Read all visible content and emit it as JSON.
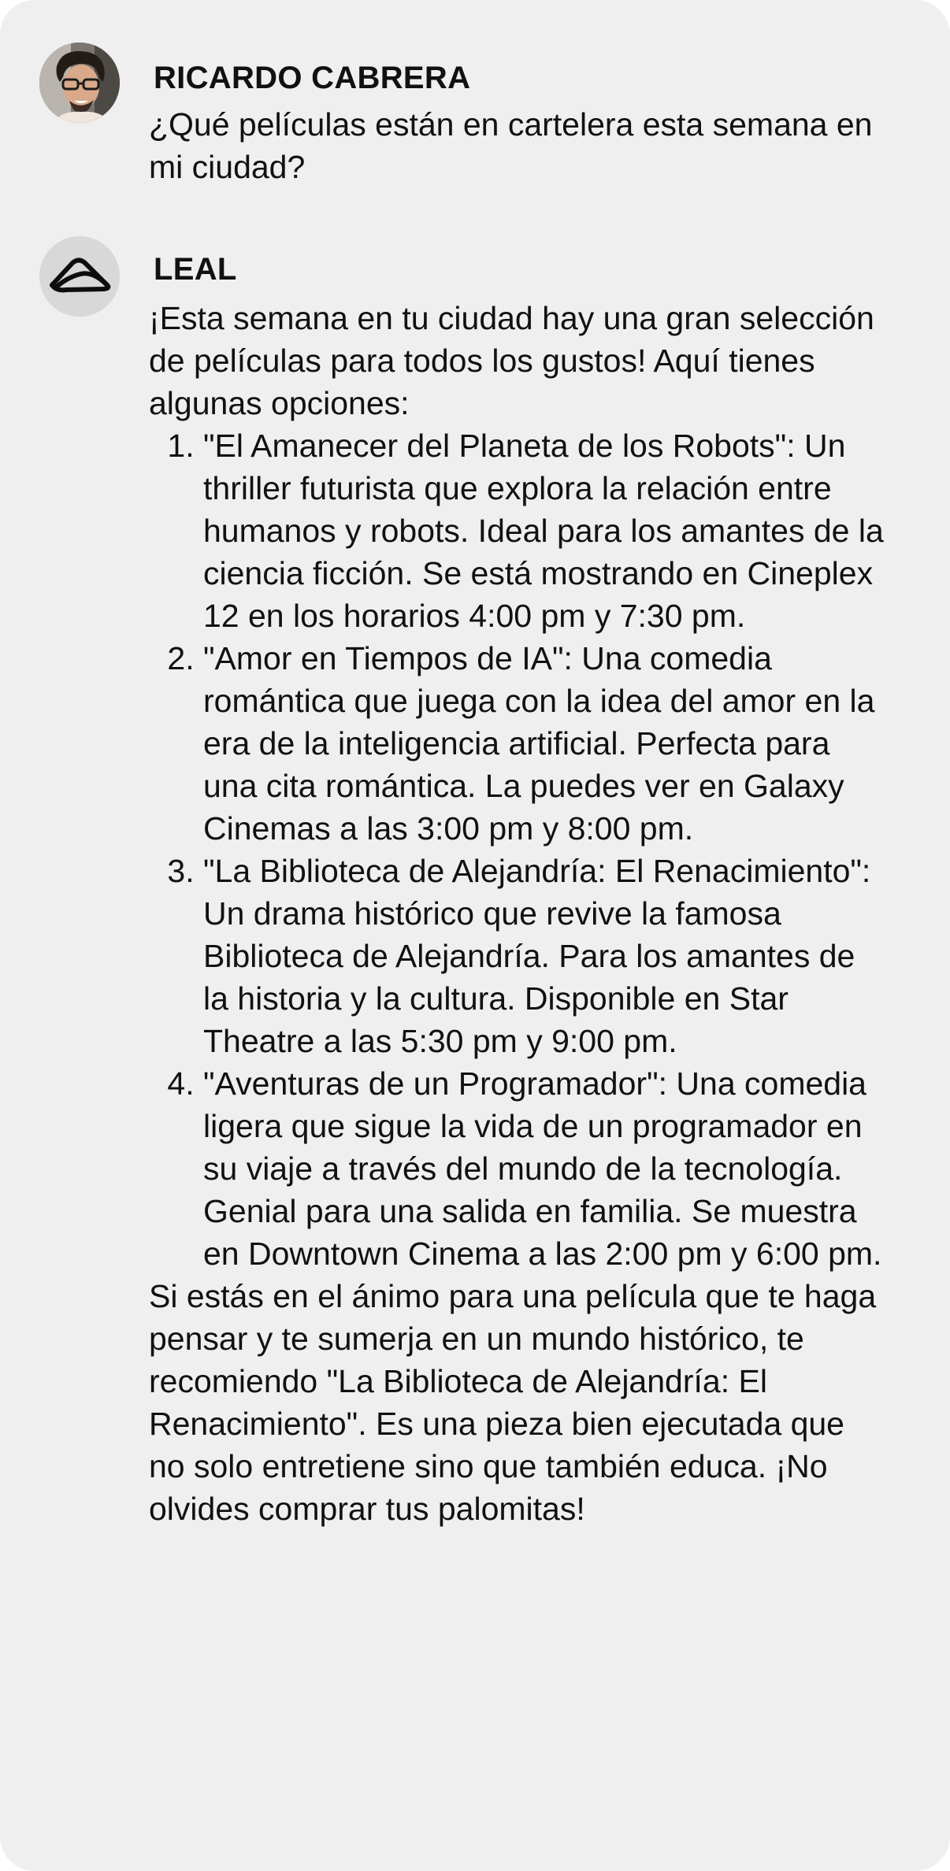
{
  "conversation": {
    "user_message": {
      "sender": "RICARDO CABRERA",
      "avatar_icon": "user-photo",
      "text": "¿Qué películas están en cartelera esta semana en mi ciudad?"
    },
    "assistant_message": {
      "sender": "LEAL",
      "avatar_icon": "leal-logo-icon",
      "intro": "¡Esta semana en tu ciudad hay una gran selección de películas para todos los gustos! Aquí tienes algunas opciones:",
      "list": [
        "\"El Amanecer del Planeta de los Robots\": Un thriller futurista que explora la relación entre humanos y robots. Ideal para los amantes de la ciencia ficción. Se está mostrando en Cineplex 12 en los horarios 4:00 pm y 7:30 pm.",
        "\"Amor en Tiempos de IA\": Una comedia romántica que juega con la idea del amor en la era de la inteligencia artificial. Perfecta para una cita romántica. La puedes ver en Galaxy Cinemas a las 3:00 pm y 8:00 pm.",
        "\"La Biblioteca de Alejandría: El Renacimiento\": Un drama histórico que revive la famosa Biblioteca de Alejandría. Para los amantes de la historia y la cultura. Disponible en Star Theatre a las 5:30 pm y 9:00 pm.",
        "\"Aventuras de un Programador\": Una comedia ligera que sigue la vida de un programador en su viaje a través del mundo de la tecnología. Genial para una salida en familia. Se muestra en Downtown Cinema a las 2:00 pm y 6:00 pm."
      ],
      "closing": "Si estás en el ánimo para una película que te haga pensar y te sumerja en un mundo histórico, te recomiendo \"La Biblioteca de Alejandría: El Renacimiento\". Es una pieza bien ejecutada que no solo entretiene sino que también educa. ¡No olvides comprar tus palomitas!"
    }
  },
  "colors": {
    "card_background": "#efefef",
    "text": "#111111",
    "bot_avatar_background": "#d8d8d8"
  }
}
